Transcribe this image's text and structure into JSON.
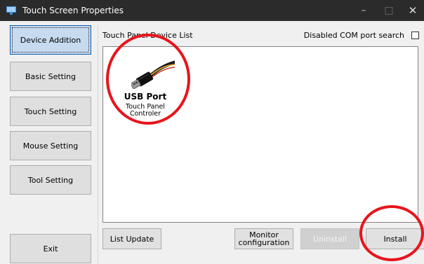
{
  "window": {
    "title": "Touch Screen Properties",
    "controls": {
      "minimize": "–",
      "maximize": "□",
      "close": "✕"
    }
  },
  "sidebar": {
    "items": [
      {
        "label": "Device Addition",
        "active": true
      },
      {
        "label": "Basic Setting",
        "active": false
      },
      {
        "label": "Touch Setting",
        "active": false
      },
      {
        "label": "Mouse Setting",
        "active": false
      },
      {
        "label": "Tool Setting",
        "active": false
      }
    ],
    "exit_label": "Exit"
  },
  "panel": {
    "list_label": "Touch Panel Device List",
    "com_search_label": "Disabled COM port search",
    "com_search_checked": false,
    "devices": [
      {
        "title": "USB Port",
        "subtitle": "Touch Panel Controler",
        "icon": "usb-plug-icon"
      }
    ]
  },
  "buttons": {
    "list_update": "List Update",
    "monitor_configuration": "Monitor configuration",
    "uninstall": "Uninstall",
    "uninstall_enabled": false,
    "install": "Install"
  },
  "colors": {
    "titlebar": "#2b2b2b",
    "active_nav": "#c8daf0",
    "highlight": "#e8141b"
  }
}
